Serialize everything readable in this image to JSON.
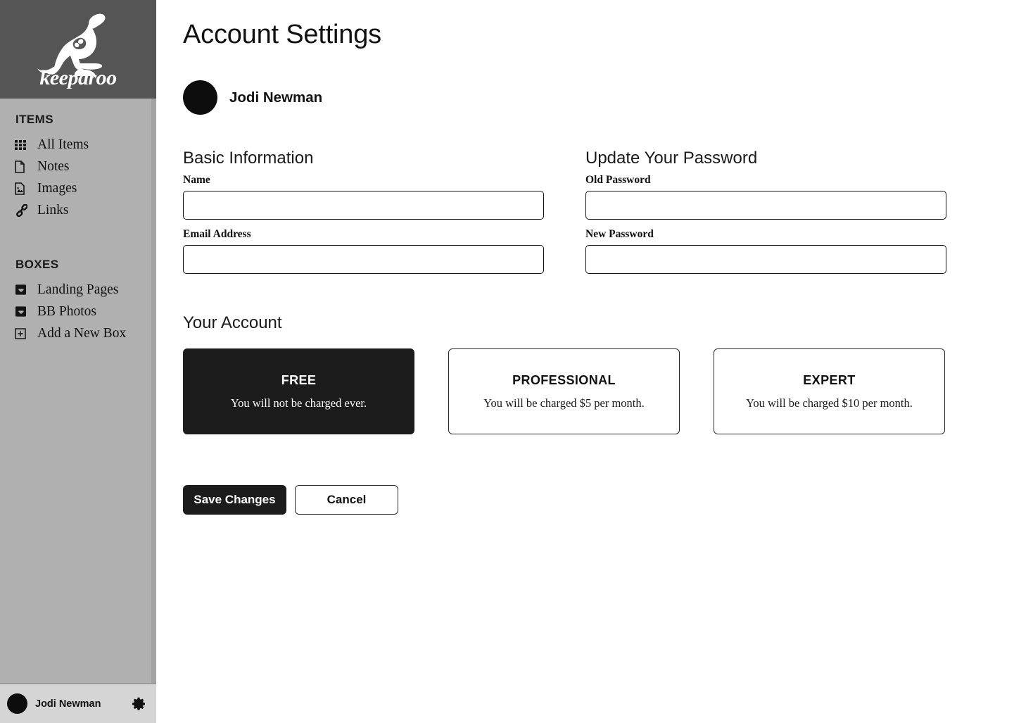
{
  "brand": {
    "name": "keeparoo",
    "logo_icon": "kangaroo-logo"
  },
  "sidebar": {
    "sections": [
      {
        "title": "ITEMS",
        "items": [
          {
            "label": "All Items",
            "icon": "grid-icon"
          },
          {
            "label": "Notes",
            "icon": "document-icon"
          },
          {
            "label": "Images",
            "icon": "image-icon"
          },
          {
            "label": "Links",
            "icon": "link-icon"
          }
        ]
      },
      {
        "title": "BOXES",
        "items": [
          {
            "label": "Landing Pages",
            "icon": "inbox-icon"
          },
          {
            "label": "BB Photos",
            "icon": "inbox-icon"
          },
          {
            "label": "Add a New Box",
            "icon": "plus-square-icon"
          }
        ]
      }
    ],
    "user_bar": {
      "name": "Jodi Newman",
      "avatar_icon": "avatar-icon",
      "settings_icon": "gear-icon"
    }
  },
  "main": {
    "page_title": "Account Settings",
    "profile": {
      "name": "Jodi Newman",
      "avatar_icon": "avatar-icon"
    },
    "basic_information": {
      "heading": "Basic Information",
      "fields": [
        {
          "label": "Name",
          "value": "",
          "placeholder": ""
        },
        {
          "label": "Email Address",
          "value": "",
          "placeholder": ""
        }
      ]
    },
    "update_password": {
      "heading": "Update Your Password",
      "fields": [
        {
          "label": "Old Password",
          "value": "",
          "placeholder": ""
        },
        {
          "label": "New Password",
          "value": "",
          "placeholder": ""
        }
      ]
    },
    "your_account": {
      "heading": "Your Account",
      "plans": [
        {
          "title": "FREE",
          "description": "You will not be charged ever.",
          "selected": true
        },
        {
          "title": "PROFESSIONAL",
          "description": "You will be charged $5 per month.",
          "selected": false
        },
        {
          "title": "EXPERT",
          "description": "You will be charged $10 per month.",
          "selected": false
        }
      ]
    },
    "actions": {
      "save_label": "Save Changes",
      "cancel_label": "Cancel"
    }
  },
  "colors": {
    "sidebar_bg": "#b0b0b0",
    "logo_panel_bg": "#555555",
    "user_bar_bg": "#d5d5d5",
    "accent_dark": "#1c1c1c",
    "page_bg": "#ffffff"
  }
}
